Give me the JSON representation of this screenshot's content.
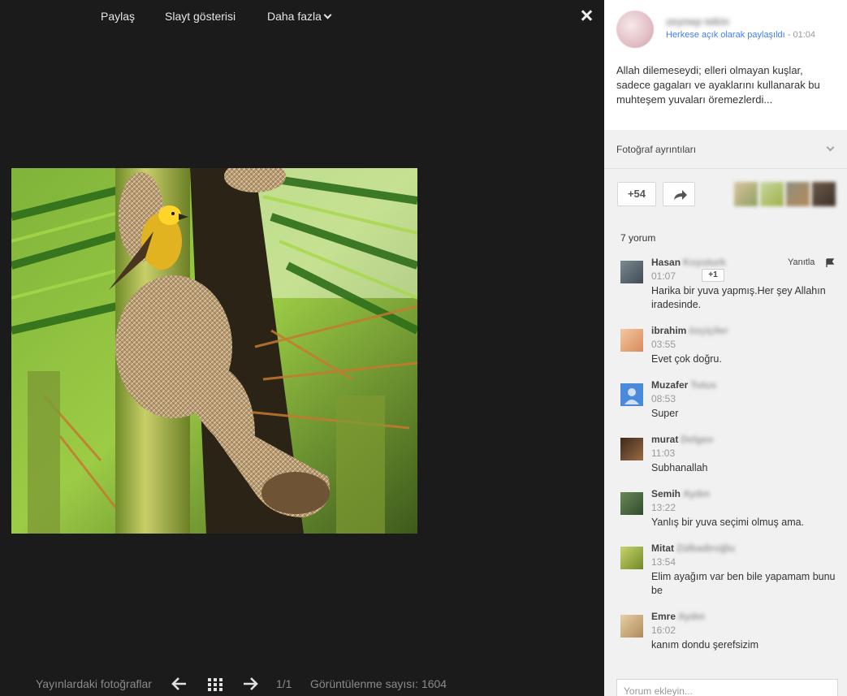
{
  "viewer": {
    "toolbar": {
      "share": "Paylaş",
      "slideshow": "Slayt gösterisi",
      "more": "Daha fazla"
    },
    "photo_alt": "Baya weaver bird on nest",
    "footer": {
      "posts_label": "Yayınlardaki fotoğraflar",
      "index": "1/1",
      "views": "Görüntülenme sayısı: 1604"
    }
  },
  "post": {
    "author": "zeynep tekin",
    "shared": "Herkese açık olarak paylaşıldı",
    "time": " - 01:04",
    "text": "Allah dilemeseydi; elleri olmayan kuşlar, sadece gagaları ve ayaklarını kullanarak bu muhteşem yuvaları öremezlerdi...",
    "details_label": "Fotoğraf ayrıntıları",
    "plus_count": "+54"
  },
  "comments": {
    "count_label": "7 yorum",
    "reply_label": "Yanıtla",
    "plus1": "+1",
    "add_placeholder": "Yorum ekleyin...",
    "items": [
      {
        "first": "Hasan",
        "last": "Koyuturk",
        "time": "01:07",
        "text": "Harika bir yuva yapmış.Her şey Allahın iradesinde."
      },
      {
        "first": "ibrahim",
        "last": "özçiçiler",
        "time": "03:55",
        "text": "Evet çok doğru."
      },
      {
        "first": "Muzafer",
        "last": "Tutus",
        "time": "08:53",
        "text": "Super"
      },
      {
        "first": "murat",
        "last": "Delgeo",
        "time": "11:03",
        "text": "Subhanallah"
      },
      {
        "first": "Semih",
        "last": "Aydın",
        "time": "13:22",
        "text": "Yanlış bir yuva seçimi olmuş ama."
      },
      {
        "first": "Mitat",
        "last": "Zülkadiroğlu",
        "time": "13:54",
        "text": "Elim ayağım var ben bile yapamam bunu be"
      },
      {
        "first": "Emre",
        "last": "Aydın",
        "time": "16:02",
        "text": "kanım dondu şerefsizim"
      }
    ]
  },
  "colors": {
    "accent_link": "#427fed",
    "viewer_bg": "#1b1b1b",
    "panel_bg": "#f1f1f1"
  }
}
